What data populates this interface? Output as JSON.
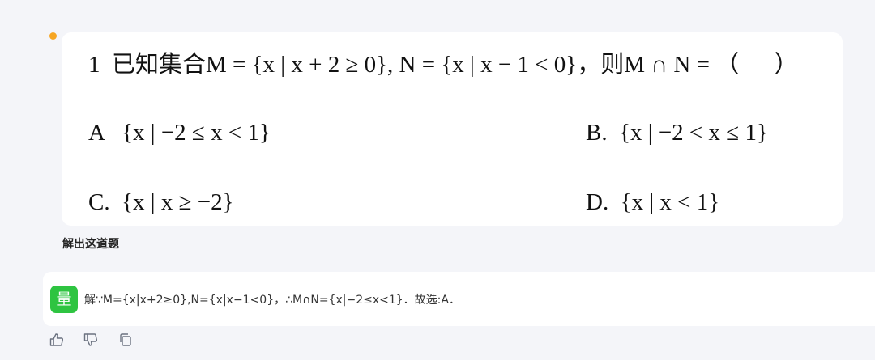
{
  "question": {
    "line": "1  已知集合M = {x | x + 2 ≥ 0}, N = {x | x − 1 < 0}，则M ∩ N = （      ）",
    "options": {
      "a": "A   {x | −2 ≤ x < 1}",
      "b": "B.  {x | −2 < x ≤ 1}",
      "c": "C.  {x | x ≥ −2}",
      "d": "D.  {x | x < 1}"
    }
  },
  "user_prompt": "解出这道题",
  "bot": {
    "avatar_text": "量",
    "answer": "解∵M={x|x+2≥0},N={x|x−1<0}，∴M∩N={x|−2≤x<1}．故选:A．"
  },
  "actions": {
    "like_icon": "thumbs-up-icon",
    "dislike_icon": "thumbs-down-icon",
    "copy_icon": "copy-icon"
  },
  "colors": {
    "background": "#f4f5f9",
    "status_dot": "#f6a623",
    "avatar_green": "#2ec441"
  }
}
